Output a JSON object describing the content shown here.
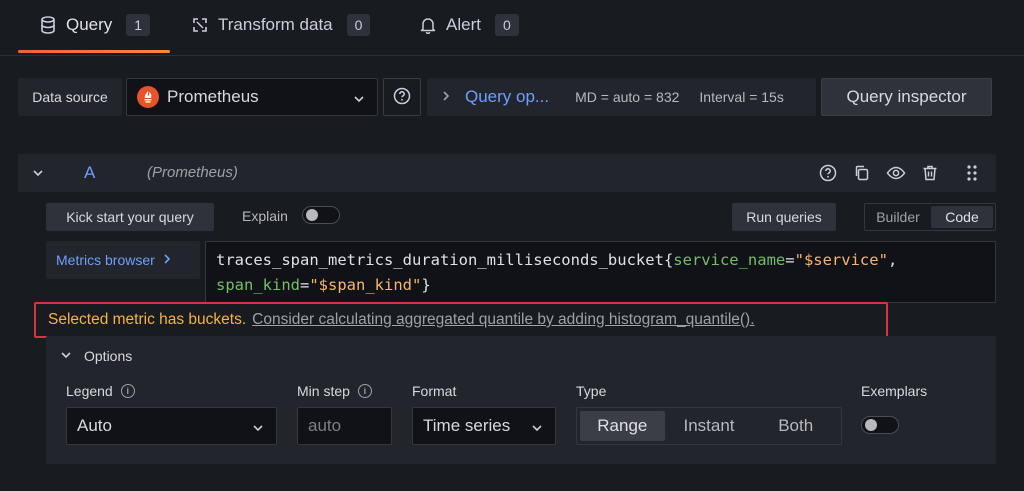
{
  "tabs": [
    {
      "label": "Query",
      "count": "1",
      "icon": "database-icon"
    },
    {
      "label": "Transform data",
      "count": "0",
      "icon": "transform-icon"
    },
    {
      "label": "Alert",
      "count": "0",
      "icon": "bell-icon"
    }
  ],
  "toolbar": {
    "data_source_label": "Data source",
    "data_source_value": "Prometheus",
    "query_options_label": "Query op...",
    "max_data_points": "MD = auto = 832",
    "interval": "Interval = 15s",
    "query_inspector_label": "Query inspector"
  },
  "query": {
    "ref_id": "A",
    "datasource": "(Prometheus)",
    "kick_start_label": "Kick start your query",
    "explain_label": "Explain",
    "explain_on": false,
    "run_queries_label": "Run queries",
    "mode_builder": "Builder",
    "mode_code": "Code",
    "active_mode": "Code",
    "metrics_browser_label": "Metrics browser",
    "code": {
      "metric": "traces_span_metrics_duration_milliseconds_bucket",
      "open_brace": "{",
      "label1": "service_name",
      "eq": "=",
      "value1": "\"$service\"",
      "comma": ",",
      "label2": "span_kind",
      "value2": "\"$span_kind\"",
      "close_brace": "}"
    },
    "warning_text": "Selected metric has buckets.",
    "warning_link": "Consider calculating aggregated quantile by adding histogram_quantile()."
  },
  "options": {
    "header": "Options",
    "legend_label": "Legend",
    "legend_value": "Auto",
    "min_step_label": "Min step",
    "min_step_placeholder": "auto",
    "format_label": "Format",
    "format_value": "Time series",
    "type_label": "Type",
    "type_options": [
      "Range",
      "Instant",
      "Both"
    ],
    "type_selected": "Range",
    "exemplars_label": "Exemplars",
    "exemplars_on": false
  },
  "colors": {
    "accent_blue": "#6e9fff",
    "warning_yellow": "#f8b33d",
    "highlight_red": "#e02f44",
    "tab_underline": "#ff8833"
  }
}
